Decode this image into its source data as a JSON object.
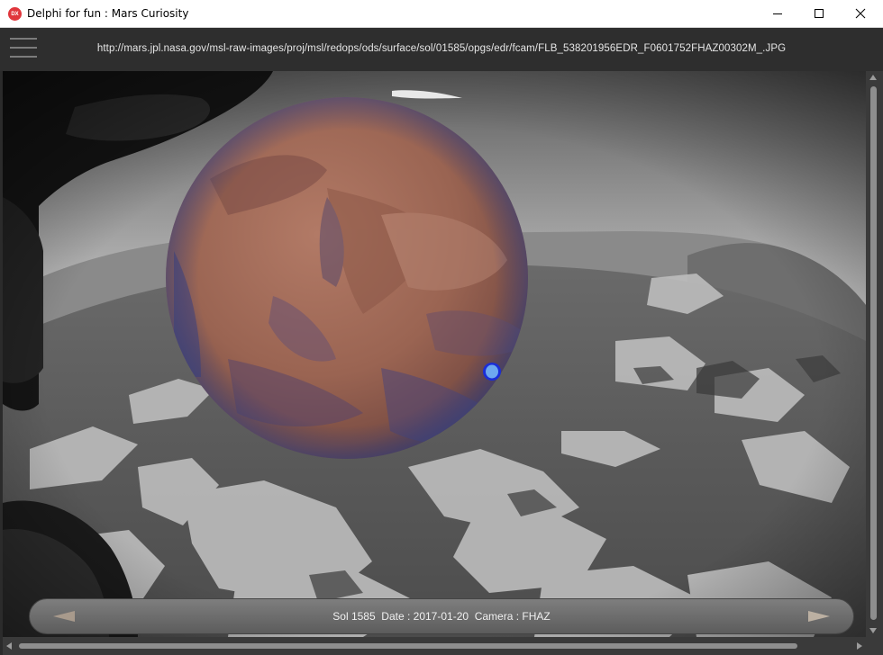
{
  "window": {
    "title": "Delphi for fun : Mars Curiosity",
    "app_icon_text": "DX",
    "icons": {
      "app": "delphi-fmx-icon",
      "minimize": "minimize-icon",
      "maximize": "maximize-icon",
      "close": "close-icon"
    }
  },
  "header": {
    "menu_icon": "hamburger-menu-icon",
    "image_url": "http://mars.jpl.nasa.gov/msl-raw-images/proj/msl/redops/ods/surface/sol/01585/opgs/edr/fcam/FLB_538201956EDR_F0601752FHAZ00302M_.JPG"
  },
  "viewer": {
    "photo": "front-hazcam-mars-surface-photo",
    "globe": "mars-globe",
    "marker": "rover-location-marker",
    "colors": {
      "mars_surface": "#a06a58",
      "marker_fill": "#6da8f0",
      "marker_ring": "#1a2ed8"
    }
  },
  "infobar": {
    "text": "Sol 1585  Date : 2017-01-20  Camera : FHAZ",
    "prev_icon": "arrow-left-icon",
    "next_icon": "arrow-right-icon"
  }
}
